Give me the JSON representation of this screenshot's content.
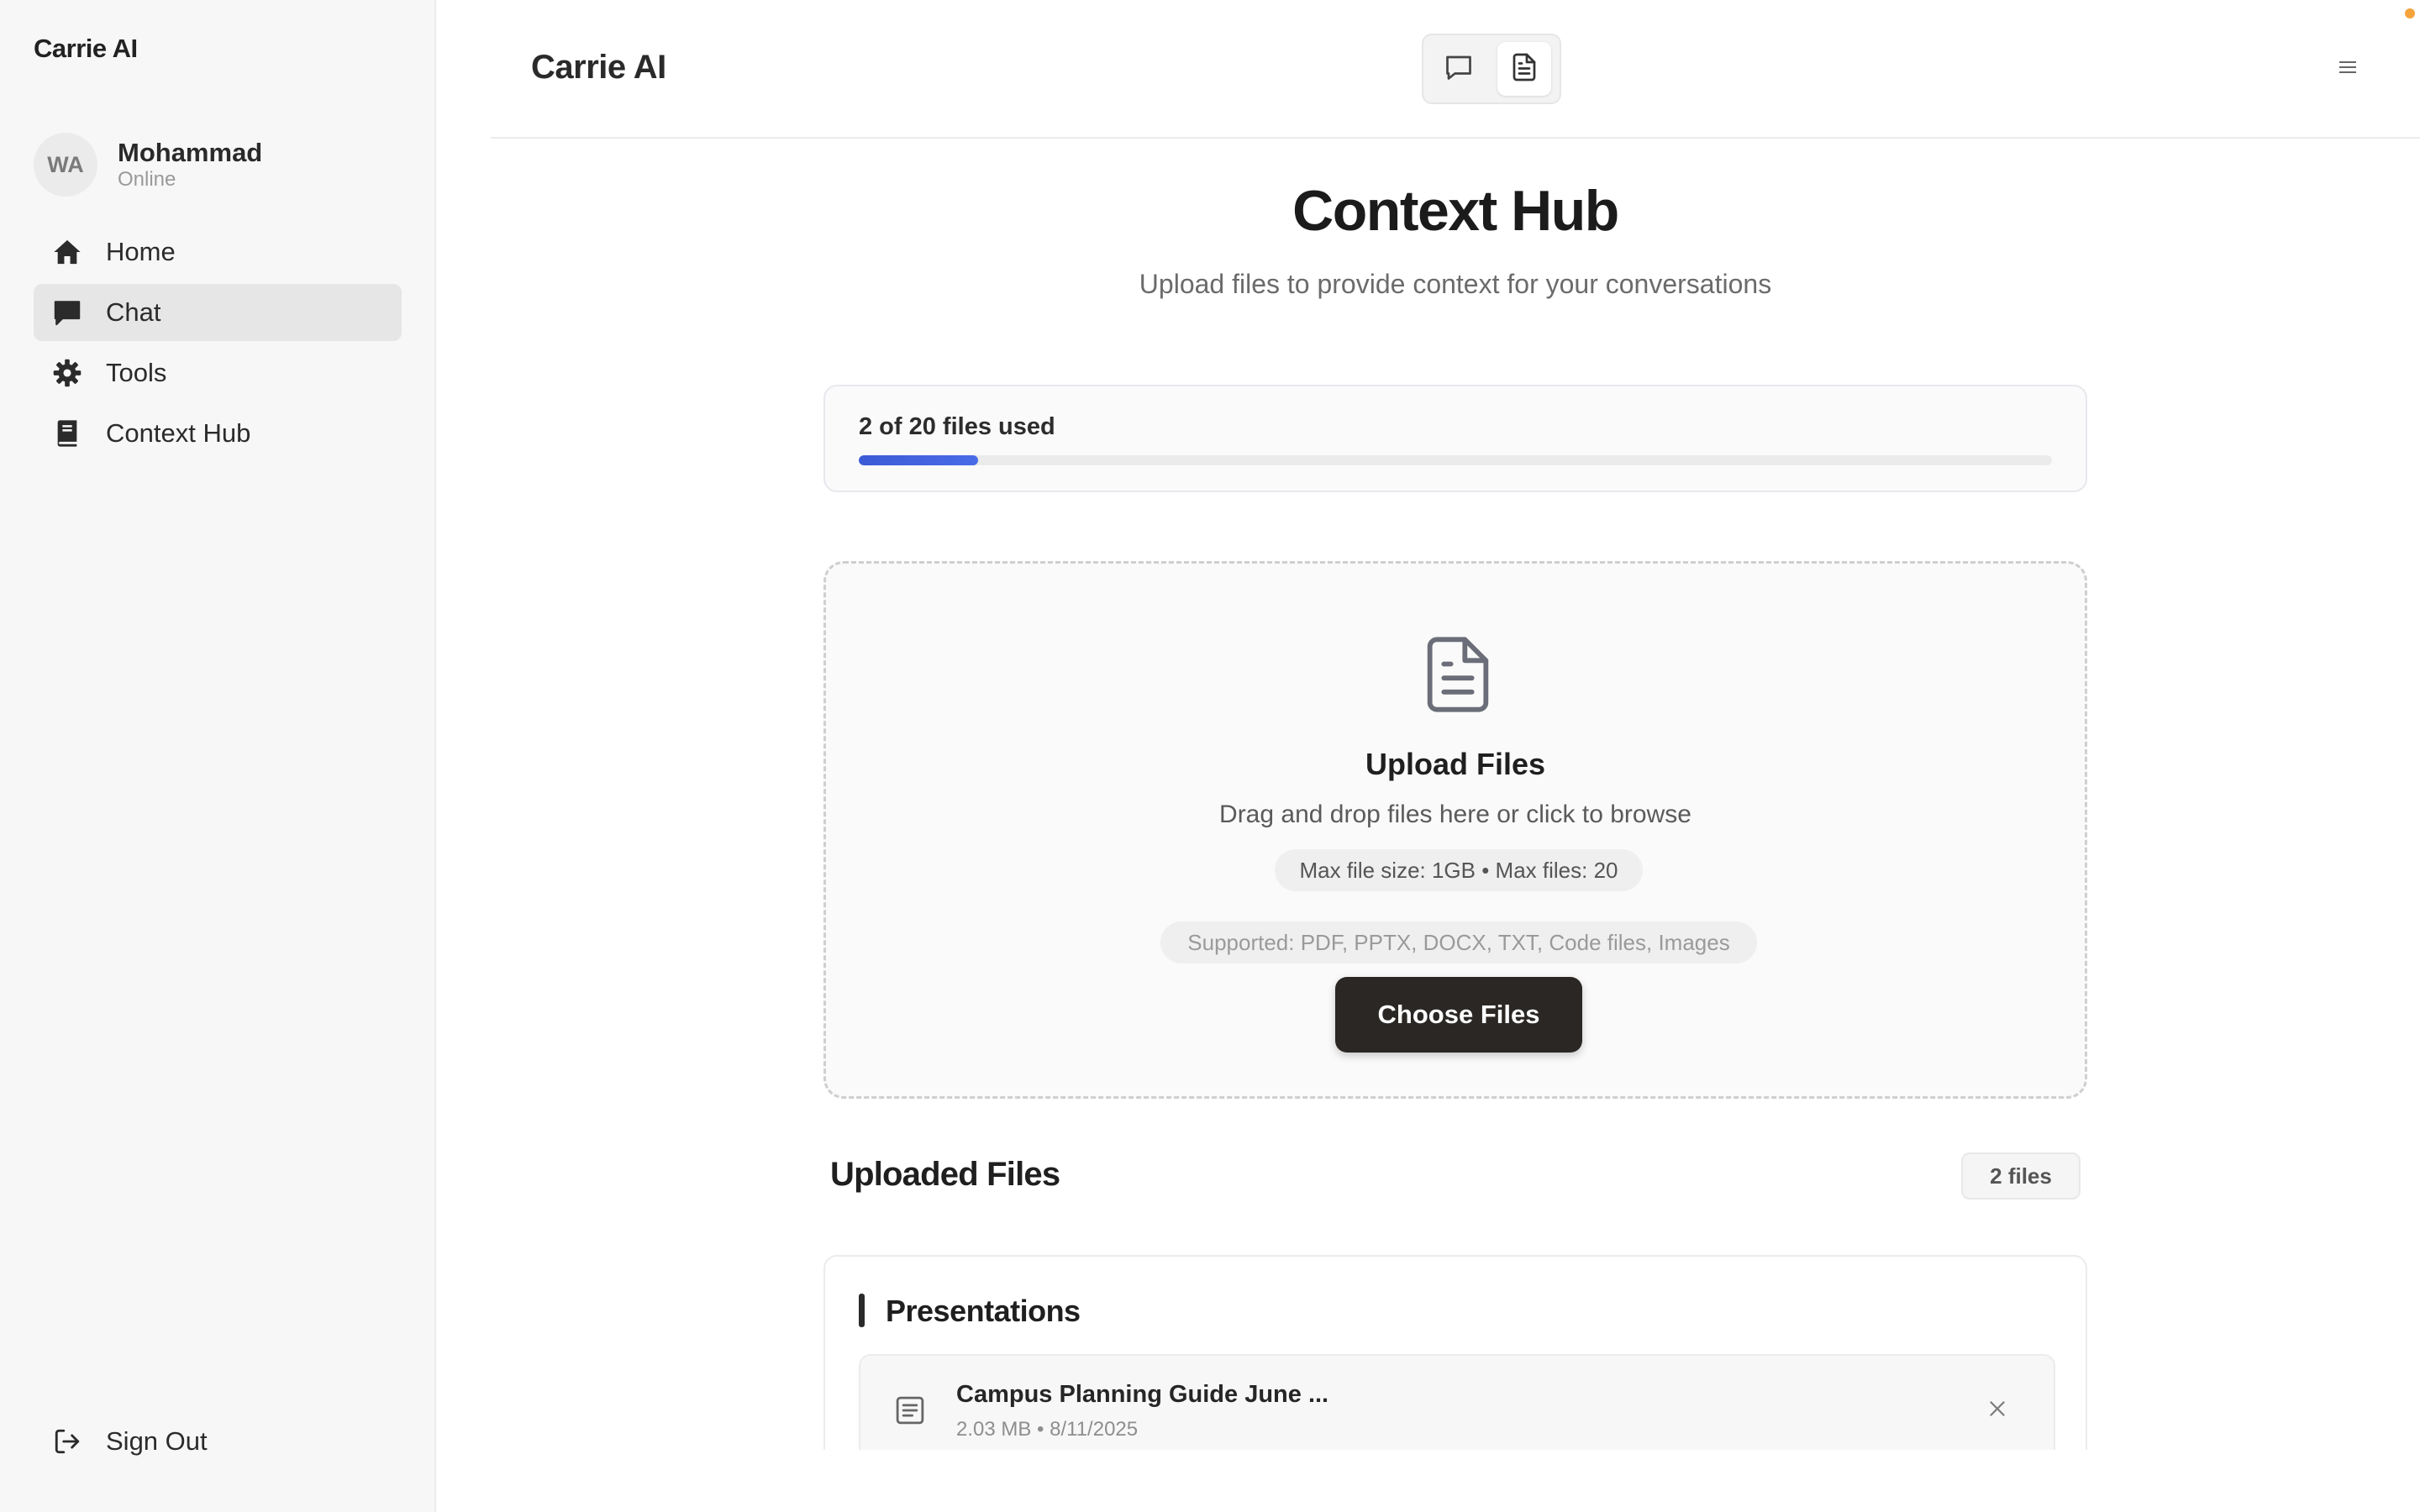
{
  "sidebar": {
    "brand": "Carrie AI",
    "user": {
      "initials": "WA",
      "name": "Mohammad",
      "status": "Online"
    },
    "items": [
      {
        "label": "Home",
        "icon": "home-icon",
        "active": false
      },
      {
        "label": "Chat",
        "icon": "chat-icon",
        "active": true
      },
      {
        "label": "Tools",
        "icon": "gear-icon",
        "active": false
      },
      {
        "label": "Context Hub",
        "icon": "book-icon",
        "active": false
      }
    ],
    "sign_out": "Sign Out"
  },
  "topbar": {
    "title": "Carrie AI",
    "view_toggle": [
      "chat-view-icon",
      "document-view-icon"
    ],
    "active_view": "document-view-icon"
  },
  "page": {
    "title": "Context Hub",
    "subtitle": "Upload files to provide context for your conversations"
  },
  "usage": {
    "text": "2 of 20 files used",
    "used": 2,
    "limit": 20,
    "progress_color": "#3b5bd6"
  },
  "dropzone": {
    "title": "Upload Files",
    "subtitle": "Drag and drop files here or click to browse",
    "limits": "Max file size: 1GB • Max files: 20",
    "supported": "Supported: PDF, PPTX, DOCX, TXT, Code files, Images",
    "button": "Choose Files"
  },
  "uploaded": {
    "title": "Uploaded Files",
    "count_label": "2 files",
    "groups": [
      {
        "title": "Presentations",
        "files": [
          {
            "name": "Campus Planning Guide June ...",
            "meta": "2.03 MB • 8/11/2025"
          }
        ]
      }
    ]
  },
  "colors": {
    "accent_dark": "#2a2724",
    "notification": "#f5a33b"
  }
}
